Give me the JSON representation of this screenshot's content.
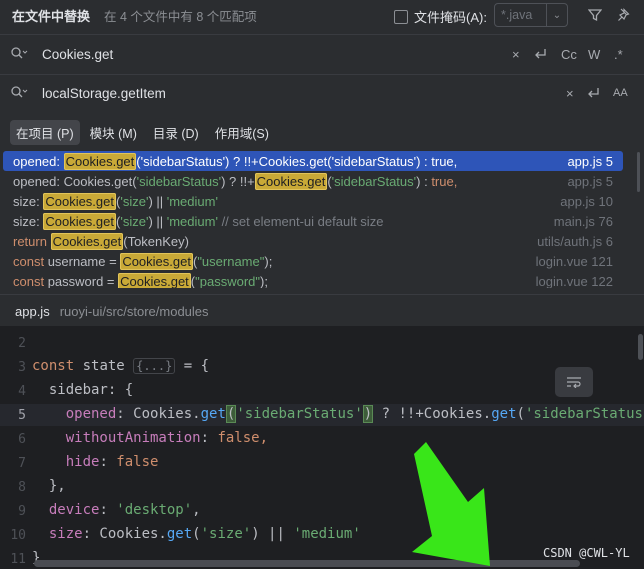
{
  "header": {
    "title": "在文件中替换",
    "summary": "在 4 个文件中有 8 个匹配项",
    "file_mask_label": "文件掩码(A):",
    "file_mask_value": "*.java",
    "icons": [
      "filter-icon",
      "pin-icon"
    ]
  },
  "search": {
    "query": "Cookies.get",
    "options": {
      "match_case": "Cc",
      "words": "W",
      "regex": ".*"
    }
  },
  "replace": {
    "value": "localStorage.getItem",
    "preserve_case": "AA"
  },
  "scope_tabs": [
    {
      "label": "在项目 (P)",
      "active": true
    },
    {
      "label": "模块 (M)",
      "active": false
    },
    {
      "label": "目录 (D)",
      "active": false
    },
    {
      "label": "作用域(S)",
      "active": false
    }
  ],
  "results": [
    {
      "pre": "opened: ",
      "match": "Cookies.get",
      "post": "('sidebarStatus') ? !!+Cookies.get('sidebarStatus') : true,",
      "file": "app.js 5",
      "selected": true
    },
    {
      "pre": "opened: Cookies.get(",
      "str1": "'sidebarStatus'",
      "mid": ") ? !!+",
      "match": "Cookies.get",
      "post2": "(",
      "str2": "'sidebarStatus'",
      "post": ") : ",
      "kwend": "true,",
      "file": "app.js 5"
    },
    {
      "pre": "size: ",
      "match": "Cookies.get",
      "post": "(",
      "str1": "'size'",
      "mid": ") || ",
      "str2": "'medium'",
      "file": "app.js 10"
    },
    {
      "pre": "size: ",
      "match": "Cookies.get",
      "post": "(",
      "str1": "'size'",
      "mid": ") || ",
      "str2": "'medium'",
      "cmt": " // set element-ui default size",
      "file": "main.js 76"
    },
    {
      "kw": "return ",
      "match": "Cookies.get",
      "post": "(TokenKey)",
      "file": "utils/auth.js 6"
    },
    {
      "kw": "const ",
      "pre": "username = ",
      "match": "Cookies.get",
      "post": "(",
      "str1": "\"username\"",
      "mid": ");",
      "file": "login.vue 121"
    },
    {
      "kw": "const ",
      "pre": "password = ",
      "match": "Cookies.get",
      "post": "(",
      "str1": "\"password\"",
      "mid": ");",
      "file": "login.vue 122"
    }
  ],
  "preview": {
    "file_name": "app.js",
    "path": "ruoyi-ui/src/store/modules",
    "line_numbers": [
      "2",
      "3",
      "4",
      "5",
      "6",
      "7",
      "8",
      "9",
      "10",
      "11"
    ],
    "current_line": "5",
    "fold_placeholder": "{...}",
    "code": {
      "l3_kw": "const",
      "l3_id": " state ",
      "l3_end": " = {",
      "l4": "  sidebar: {",
      "l5_prop": "opened",
      "l5_a": ": Cookies.",
      "l5_fn": "get",
      "l5_str": "'sidebarStatus'",
      "l5_b": " ? !!+Cookies.",
      "l5_fn2": "get",
      "l5_str2": "'sidebarStatus'",
      "l6_prop": "withoutAnimation",
      "l6_val": "false,",
      "l7_prop": "hide",
      "l7_val": "false",
      "l8": "  },",
      "l9_prop": "device",
      "l9_str": "'desktop'",
      "l10_prop": "size",
      "l10_a": ": Cookies.",
      "l10_fn": "get",
      "l10_str": "'size'",
      "l10_b": ") || ",
      "l10_str2": "'medium'",
      "l11": "}"
    }
  },
  "watermark": "CSDN @CWL-YL",
  "colors": {
    "selection": "#2e55b8",
    "match_highlight": "#c9a937",
    "annotation_arrow": "#39e619"
  }
}
